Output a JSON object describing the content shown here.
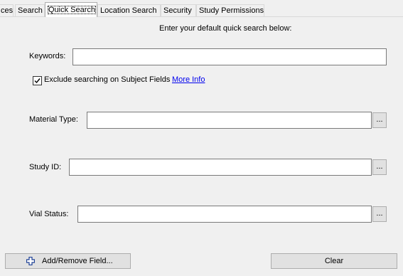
{
  "tabs": [
    {
      "label": "ces"
    },
    {
      "label": "Search"
    },
    {
      "label": "Quick Search",
      "active": true
    },
    {
      "label": "Location Search"
    },
    {
      "label": "Security"
    },
    {
      "label": "Study Permissions"
    }
  ],
  "intro_text": "Enter your default quick search below:",
  "fields": {
    "keywords": {
      "label": "Keywords:",
      "value": ""
    },
    "material_type": {
      "label": "Material Type:",
      "value": ""
    },
    "study_id": {
      "label": "Study ID:",
      "value": ""
    },
    "vial_status": {
      "label": "Vial Status:",
      "value": ""
    }
  },
  "browse_label": "...",
  "exclude_subject": {
    "label": "Exclude searching on Subject Fields",
    "checked": true
  },
  "more_info_link": "More Info",
  "buttons": {
    "add_remove": "Add/Remove Field...",
    "clear": "Clear"
  },
  "icons": {
    "checkmark": "check-icon",
    "add": "plus-icon"
  },
  "colors": {
    "link": "#0000ee",
    "plus_icon": "#1c3f95"
  }
}
